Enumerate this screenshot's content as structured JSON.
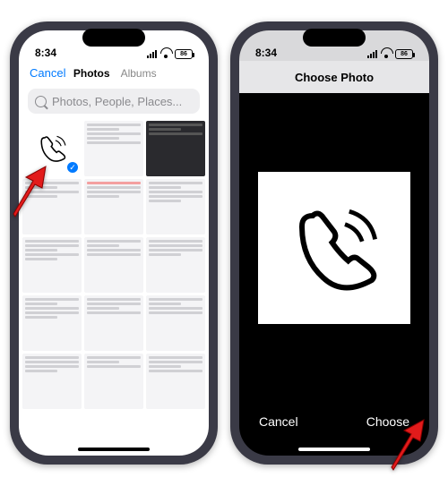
{
  "status": {
    "time": "8:34",
    "battery": "86"
  },
  "left": {
    "cancel": "Cancel",
    "tabs": {
      "photos": "Photos",
      "albums": "Albums"
    },
    "search_placeholder": "Photos, People, Places..."
  },
  "right": {
    "title": "Choose Photo",
    "cancel": "Cancel",
    "choose": "Choose"
  }
}
